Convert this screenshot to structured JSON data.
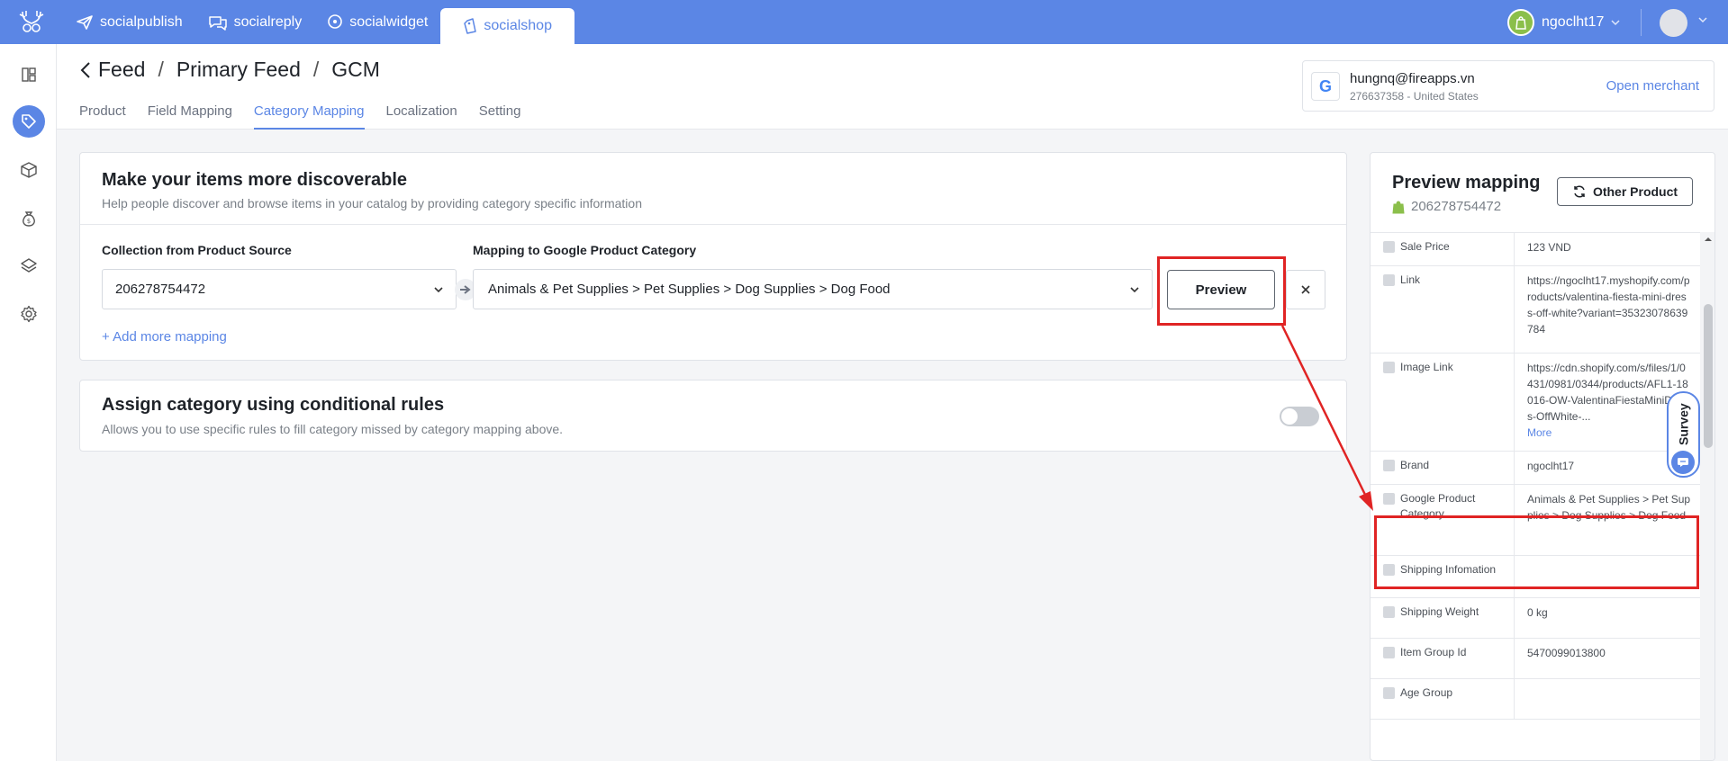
{
  "topnav": {
    "items": [
      {
        "label": "socialpublish",
        "icon": "paper-plane-icon"
      },
      {
        "label": "socialreply",
        "icon": "chat-bubbles-icon"
      },
      {
        "label": "socialwidget",
        "icon": "location-pin-icon"
      },
      {
        "label": "socialshop",
        "icon": "shopping-tag-icon"
      }
    ],
    "active": "socialshop",
    "user_name": "ngoclht17"
  },
  "sidebar": {
    "items": [
      "layout-icon",
      "tag-icon",
      "box-icon",
      "money-bag-icon",
      "layers-icon",
      "gear-icon"
    ],
    "active": "tag-icon"
  },
  "breadcrumb": {
    "items": [
      "Feed",
      "Primary Feed",
      "GCM"
    ]
  },
  "tabs": {
    "items": [
      "Product",
      "Field Mapping",
      "Category Mapping",
      "Localization",
      "Setting"
    ],
    "active": "Category Mapping"
  },
  "merchant": {
    "email": "hungnq@fireapps.vn",
    "sub": "276637358 - United States",
    "open_label": "Open merchant",
    "logo_letter": "G"
  },
  "mapping_card": {
    "title": "Make your items more discoverable",
    "description": "Help people discover and browse items in your catalog by providing category specific information",
    "collection_label": "Collection from Product Source",
    "category_label": "Mapping to Google Product Category",
    "collection_value": "206278754472",
    "category_value": "Animals & Pet Supplies > Pet Supplies > Dog Supplies > Dog Food",
    "preview_label": "Preview",
    "add_mapping_label": "+ Add more mapping"
  },
  "rules_card": {
    "title": "Assign category using conditional rules",
    "description": "Allows you to use specific rules to fill category missed by category mapping above.",
    "toggle_on": false
  },
  "preview_panel": {
    "title": "Preview mapping",
    "product_id": "206278754472",
    "other_product_label": "Other Product",
    "rows": [
      {
        "key": "Sale Price",
        "value": "123 VND"
      },
      {
        "key": "Link",
        "value": "https://ngoclht17.myshopify.com/products/valentina-fiesta-mini-dress-off-white?variant=35323078639784"
      },
      {
        "key": "Image Link",
        "value": "https://cdn.shopify.com/s/files/1/0431/0981/0344/products/AFL1-18016-OW-ValentinaFiestaMiniDress-OffWhite-...",
        "more": "More"
      },
      {
        "key": "Brand",
        "value": "ngoclht17"
      },
      {
        "key": "Google Product Category",
        "value": "Animals & Pet Supplies > Pet Supplies > Dog Supplies > Dog Food"
      },
      {
        "key": "Shipping Infomation",
        "value": ""
      },
      {
        "key": "Shipping Weight",
        "value": "0 kg"
      },
      {
        "key": "Item Group Id",
        "value": "5470099013800"
      },
      {
        "key": "Age Group",
        "value": ""
      }
    ]
  },
  "survey": {
    "label": "Survey"
  },
  "colors": {
    "accent": "#5b86e5",
    "highlight": "#e02424",
    "shop_green": "#8bbf4b"
  }
}
